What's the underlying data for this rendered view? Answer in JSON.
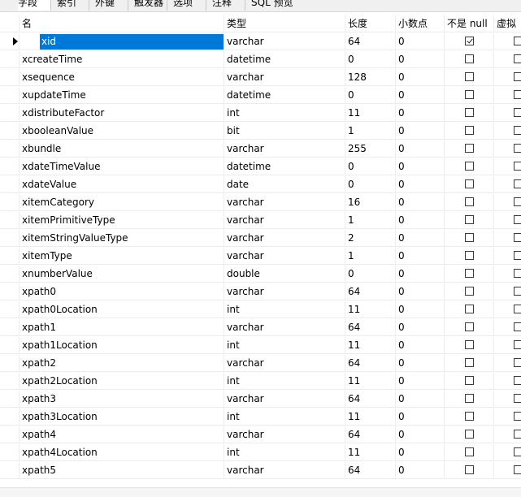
{
  "tabs": [
    {
      "label": "字段",
      "active": true
    },
    {
      "label": "索引"
    },
    {
      "label": "外键"
    },
    {
      "label": "触发器"
    },
    {
      "label": "选项"
    },
    {
      "label": "注释"
    },
    {
      "label": "SQL 预览"
    }
  ],
  "columns": [
    "名",
    "类型",
    "长度",
    "小数点",
    "不是 null",
    "虚拟"
  ],
  "rows": [
    {
      "name": "xid",
      "type": "varchar",
      "length": "64",
      "decimals": "0",
      "not_null": true,
      "selected": true
    },
    {
      "name": "xcreateTime",
      "type": "datetime",
      "length": "0",
      "decimals": "0",
      "not_null": false
    },
    {
      "name": "xsequence",
      "type": "varchar",
      "length": "128",
      "decimals": "0",
      "not_null": false
    },
    {
      "name": "xupdateTime",
      "type": "datetime",
      "length": "0",
      "decimals": "0",
      "not_null": false
    },
    {
      "name": "xdistributeFactor",
      "type": "int",
      "length": "11",
      "decimals": "0",
      "not_null": false
    },
    {
      "name": "xbooleanValue",
      "type": "bit",
      "length": "1",
      "decimals": "0",
      "not_null": false
    },
    {
      "name": "xbundle",
      "type": "varchar",
      "length": "255",
      "decimals": "0",
      "not_null": false
    },
    {
      "name": "xdateTimeValue",
      "type": "datetime",
      "length": "0",
      "decimals": "0",
      "not_null": false
    },
    {
      "name": "xdateValue",
      "type": "date",
      "length": "0",
      "decimals": "0",
      "not_null": false
    },
    {
      "name": "xitemCategory",
      "type": "varchar",
      "length": "16",
      "decimals": "0",
      "not_null": false
    },
    {
      "name": "xitemPrimitiveType",
      "type": "varchar",
      "length": "1",
      "decimals": "0",
      "not_null": false
    },
    {
      "name": "xitemStringValueType",
      "type": "varchar",
      "length": "2",
      "decimals": "0",
      "not_null": false
    },
    {
      "name": "xitemType",
      "type": "varchar",
      "length": "1",
      "decimals": "0",
      "not_null": false
    },
    {
      "name": "xnumberValue",
      "type": "double",
      "length": "0",
      "decimals": "0",
      "not_null": false
    },
    {
      "name": "xpath0",
      "type": "varchar",
      "length": "64",
      "decimals": "0",
      "not_null": false
    },
    {
      "name": "xpath0Location",
      "type": "int",
      "length": "11",
      "decimals": "0",
      "not_null": false
    },
    {
      "name": "xpath1",
      "type": "varchar",
      "length": "64",
      "decimals": "0",
      "not_null": false
    },
    {
      "name": "xpath1Location",
      "type": "int",
      "length": "11",
      "decimals": "0",
      "not_null": false
    },
    {
      "name": "xpath2",
      "type": "varchar",
      "length": "64",
      "decimals": "0",
      "not_null": false
    },
    {
      "name": "xpath2Location",
      "type": "int",
      "length": "11",
      "decimals": "0",
      "not_null": false
    },
    {
      "name": "xpath3",
      "type": "varchar",
      "length": "64",
      "decimals": "0",
      "not_null": false
    },
    {
      "name": "xpath3Location",
      "type": "int",
      "length": "11",
      "decimals": "0",
      "not_null": false
    },
    {
      "name": "xpath4",
      "type": "varchar",
      "length": "64",
      "decimals": "0",
      "not_null": false
    },
    {
      "name": "xpath4Location",
      "type": "int",
      "length": "11",
      "decimals": "0",
      "not_null": false
    },
    {
      "name": "xpath5",
      "type": "varchar",
      "length": "64",
      "decimals": "0",
      "not_null": false
    }
  ],
  "colors": {
    "selection": "#0078d7",
    "gridline": "#ececec"
  }
}
